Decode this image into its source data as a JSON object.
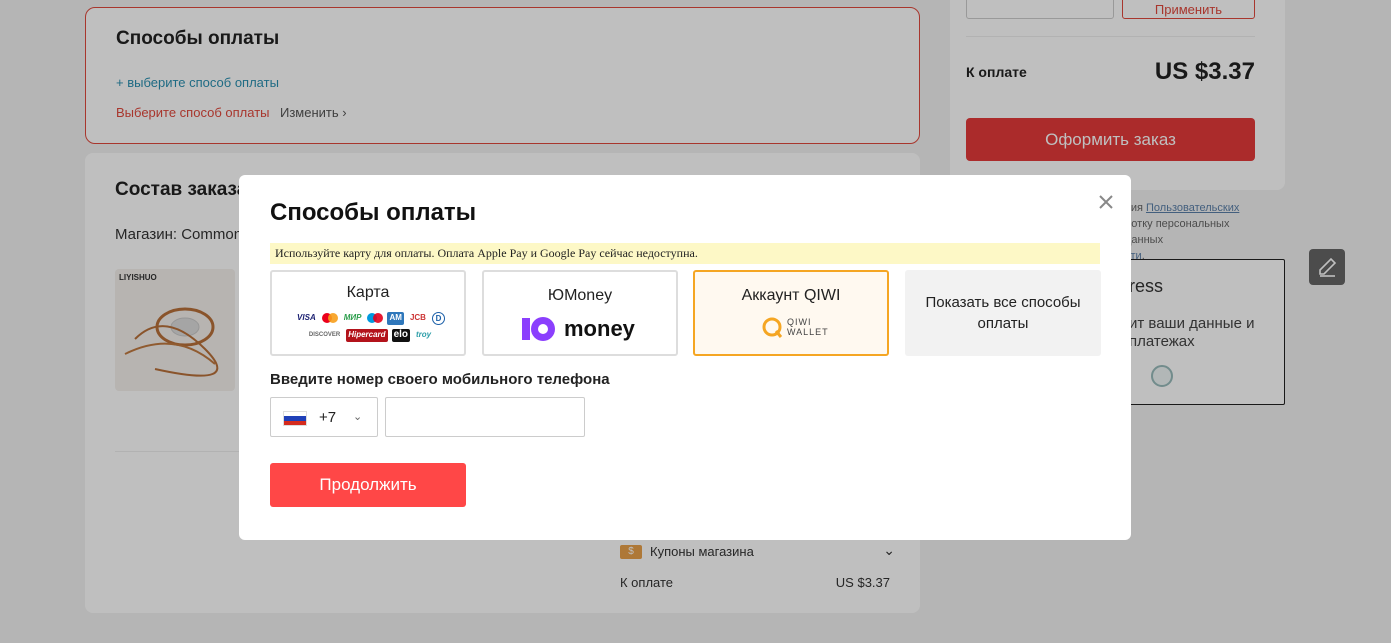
{
  "page": {
    "payment_section": {
      "title": "Способы оплаты",
      "choose_link": "+ выберите способ оплаты",
      "error": "Выберите способ оплаты",
      "change": "Изменить"
    },
    "order_section": {
      "title": "Состав заказа",
      "shop_label": "Магазин: Common",
      "product_brand": "LIYISHUO",
      "coupons_label": "Купоны магазина",
      "total_label": "К оплате",
      "total_value": "US $3.37"
    },
    "summary": {
      "apply_label": "Применить",
      "pay_label": "К оплате",
      "pay_value": "US $3.37",
      "order_button": "Оформить заказ",
      "terms_prefix": "вия",
      "terms_link1": "Пользовательских",
      "terms_mid": "ботку персональных данных",
      "terms_link2": "сти",
      "safe_title": "ress",
      "safe_text": "ит ваши данные и платежах"
    }
  },
  "modal": {
    "title": "Способы оплаты",
    "notice": "Используйте карту для оплаты. Оплата Apple Pay и Google Pay сейчас недоступна.",
    "methods": [
      {
        "label": "Карта",
        "selected": false
      },
      {
        "label": "ЮMoney",
        "logo_text": "money",
        "selected": false
      },
      {
        "label": "Аккаунт QIWI",
        "logo_text_top": "QIWI",
        "logo_text_bottom": "WALLET",
        "selected": true
      },
      {
        "label": "Показать все способы оплаты",
        "selected": false
      }
    ],
    "card_brands": {
      "visa": "VISA",
      "mir": "МИР",
      "jcb": "JCB",
      "diners": "D",
      "amex": "AM",
      "discover": "DISCOVER",
      "hipercard": "Hipercard",
      "elo": "elo",
      "troy": "troy"
    },
    "phone_label": "Введите номер своего мобильного телефона",
    "country_code": "+7",
    "phone_value": "",
    "continue_button": "Продолжить"
  },
  "colors": {
    "accent_red": "#ff4747",
    "selected_border": "#f5a623",
    "notice_bg": "#fdf8c6"
  }
}
